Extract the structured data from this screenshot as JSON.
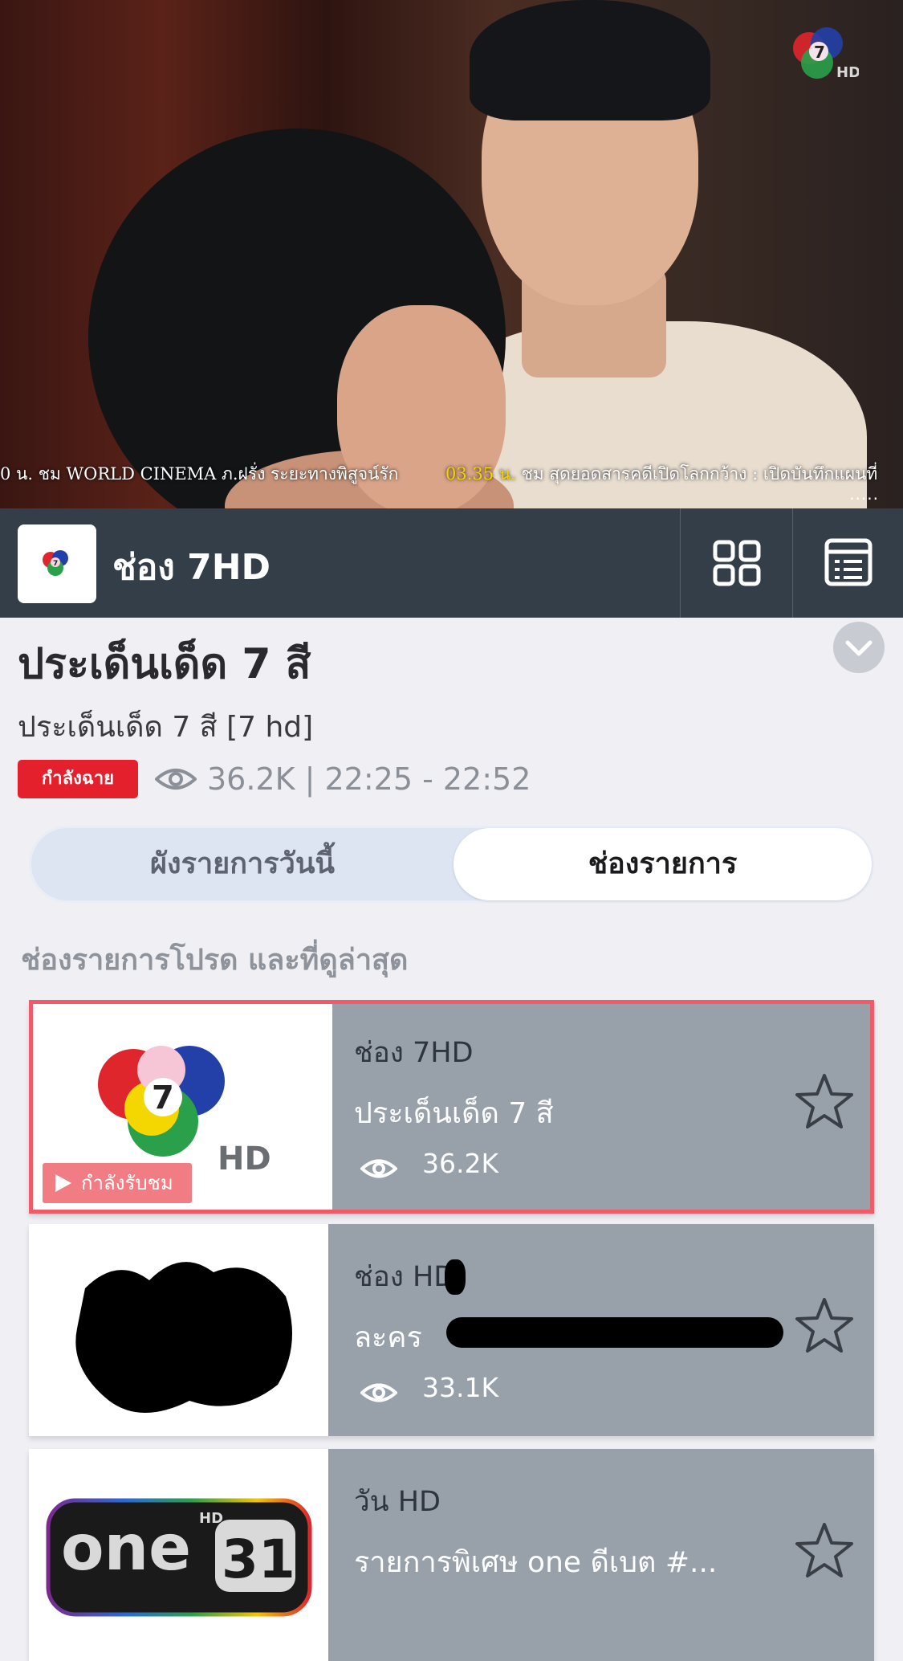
{
  "video": {
    "ticker_left": "0 น. ชม WORLD CINEMA ภ.ฝรั่ง ระยะทางพิสูจน์รัก",
    "ticker_time": "03.35 น.",
    "ticker_right": " ชม สุดยอดสารคดีเปิดโลกกว้าง : เปิดบันทึกแผนที่",
    "ticker_dots": "....."
  },
  "header": {
    "channel_title": "ช่อง 7HD"
  },
  "program": {
    "title": "ประเด็นเด็ด 7 สี",
    "subtitle": "ประเด็นเด็ด 7 สี [7 hd]",
    "live_badge": "กำลังฉาย",
    "views_and_time": "36.2K | 22:25 - 22:52"
  },
  "tabs": {
    "today_schedule": "ผังรายการวันนี้",
    "channels": "ช่องรายการ"
  },
  "section_heading": "ช่องรายการโปรด และที่ดูล่าสุด",
  "cards": [
    {
      "channel": "ช่อง 7HD",
      "show": "ประเด็นเด็ด 7 สี",
      "views": "36.2K",
      "watching_label": "กำลังรับชม"
    },
    {
      "channel": "ช่อง   HD",
      "show": "ละคร",
      "views": "33.1K"
    },
    {
      "channel": "วัน HD",
      "show": "รายการพิเศษ one ดีเบต #...",
      "views": ""
    }
  ],
  "colors": {
    "header_bg": "#343e48",
    "live_red": "#e3202c",
    "active_border": "#ef5b68",
    "card_bg": "#98a0aa",
    "page_bg": "#efeff4"
  }
}
